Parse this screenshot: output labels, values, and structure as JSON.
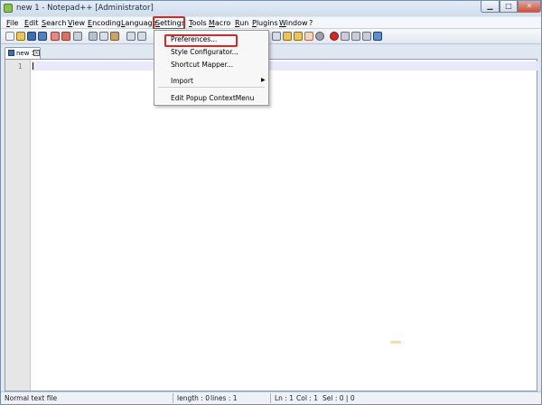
{
  "window": {
    "title": "new 1 - Notepad++ [Administrator]"
  },
  "window_controls": {
    "minimize": "▁",
    "maximize": "□",
    "close": "✕"
  },
  "menubar": {
    "items": [
      "File",
      "Edit",
      "Search",
      "View",
      "Encoding",
      "Language",
      "Settings",
      "Tools",
      "Macro",
      "Run",
      "Plugins",
      "Window",
      "?"
    ],
    "close_doc": "X"
  },
  "settings_menu": {
    "items": [
      "Preferences...",
      "Style Configurator...",
      "Shortcut Mapper...",
      "Import",
      "Edit Popup ContextMenu"
    ]
  },
  "tab": {
    "label": "new 1",
    "close": "×"
  },
  "editor": {
    "line_number": "1"
  },
  "status": {
    "type": "Normal text file",
    "length": "length : 0",
    "lines": "lines : 1",
    "ln": "Ln : 1",
    "col": "Col : 1",
    "sel": "Sel : 0 | 0"
  },
  "colors": {
    "highlight": "#d12a2a",
    "current_line": "#e8e8ff"
  },
  "icons": [
    "notepad-plus-icon",
    "new-file-icon",
    "open-file-icon",
    "save-icon",
    "save-all-icon",
    "close-icon",
    "close-all-icon",
    "print-icon",
    "cut-icon",
    "copy-icon",
    "paste-icon",
    "undo-icon",
    "redo-icon",
    "find-icon",
    "replace-icon",
    "zoom-in-icon",
    "zoom-out-icon",
    "wrap-icon",
    "indent-guide-icon",
    "record-macro-icon",
    "stop-macro-icon",
    "play-macro-icon",
    "run-macro-icon",
    "save-macro-icon"
  ]
}
